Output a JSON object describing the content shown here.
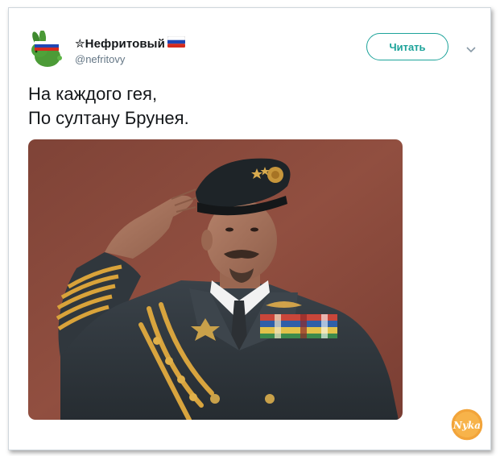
{
  "tweet": {
    "author": {
      "display_name": "✮Нефритовый",
      "handle": "@nefritovy",
      "avatar_icon": "green-rabbit-with-russian-flag-avatar",
      "name_flag_icon": "russian-flag-icon"
    },
    "follow_label": "Читать",
    "menu_icon": "chevron-down-icon",
    "text_lines": [
      "На каждого гея,",
      "По султану Брунея."
    ],
    "media_icon": "photo-man-saluting-in-military-uniform",
    "watermark_text": "Nyka"
  },
  "colors": {
    "accent": "#1da39a",
    "text": "#14171a",
    "secondary": "#657786",
    "border": "#cfd6dc",
    "photo_background": "#8a4a3c"
  }
}
